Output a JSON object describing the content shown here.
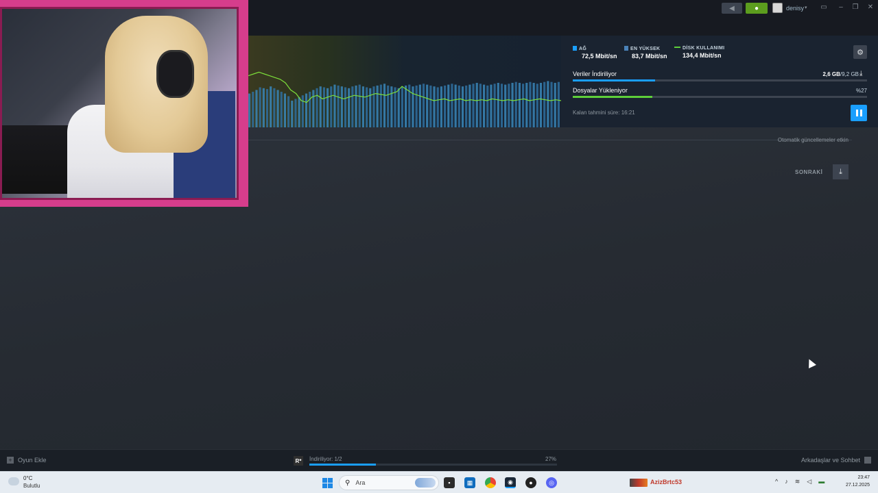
{
  "titlebar": {
    "username": "denisy"
  },
  "stats": {
    "network": {
      "label": "AĞ",
      "value": "72,5 Mbit/sn",
      "color": "#1a9fff"
    },
    "peak": {
      "label": "EN YÜKSEK",
      "value": "83,7 Mbit/sn",
      "color": "#4a82b8"
    },
    "disk": {
      "label": "DİSK KULLANIMI",
      "value": "134,4 Mbit/sn",
      "color": "#5ecf3a"
    }
  },
  "progress": {
    "download": {
      "label": "Veriler İndiriliyor",
      "value": "2,6 GB",
      "total": "/9,2 GB",
      "fraction": 0.28,
      "color": "#1a9fff"
    },
    "install": {
      "label": "Dosyalar Yükleniyor",
      "value": "%27",
      "fraction": 0.27,
      "color": "#5ecf3a"
    }
  },
  "eta": "Kalan tahmini süre: 16:21",
  "main": {
    "auto_updates": "Otomatik güncellemeler etkin",
    "next_label": "SONRAKİ"
  },
  "bottombar": {
    "add_game": "Oyun Ekle",
    "game_icon_text": "R*",
    "downloading": "İndiriliyor: 1/2",
    "percent": "27%",
    "progress_fraction": 0.27,
    "friends": "Arkadaşlar ve Sohbet"
  },
  "taskbar": {
    "temperature": "0°C",
    "weather": "Bulutlu",
    "search_placeholder": "Ara",
    "tray_text": "AzizBrtc53",
    "time": "23:47",
    "date": "27.12.2025"
  },
  "graph": {
    "bars": [
      38,
      40,
      42,
      45,
      44,
      43,
      46,
      44,
      42,
      40,
      38,
      35,
      30,
      32,
      34,
      36,
      38,
      40,
      42,
      44,
      46,
      45,
      44,
      46,
      48,
      47,
      46,
      45,
      44,
      46,
      47,
      48,
      46,
      45,
      44,
      46,
      47,
      48,
      49,
      47,
      46,
      45,
      44,
      46,
      47,
      48,
      46,
      47,
      48,
      49,
      48,
      47,
      46,
      45,
      46,
      47,
      48,
      49,
      48,
      47,
      46,
      47,
      48,
      49,
      50,
      49,
      48,
      47,
      48,
      49,
      50,
      49,
      48,
      49,
      50,
      51,
      50,
      49,
      50,
      51,
      50,
      49,
      50,
      51,
      52,
      51,
      50,
      51
    ],
    "line": [
      58,
      60,
      62,
      60,
      58,
      56,
      54,
      50,
      42,
      38,
      30,
      28,
      34,
      36,
      32,
      34,
      36,
      34,
      32,
      34,
      36,
      35,
      34,
      36,
      38,
      37,
      36,
      38,
      40,
      46,
      42,
      38,
      36,
      34,
      32,
      30,
      31,
      32,
      30,
      31,
      32,
      30,
      31,
      30,
      31,
      30,
      32,
      31,
      30,
      31,
      30,
      31,
      32,
      30,
      31,
      32,
      31,
      30,
      31,
      30
    ]
  }
}
